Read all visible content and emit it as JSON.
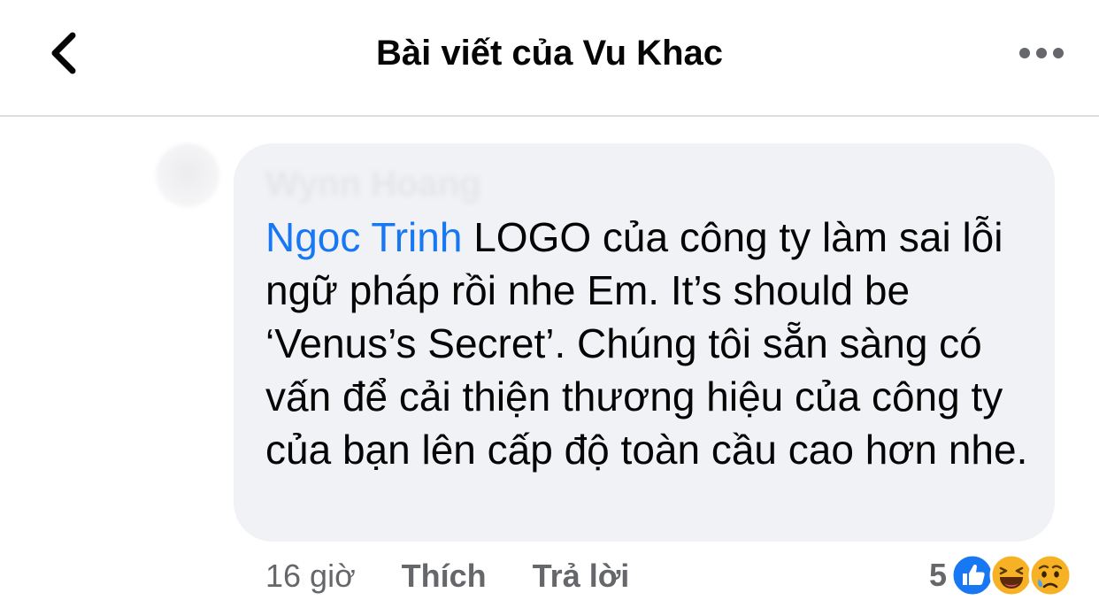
{
  "header": {
    "title": "Bài viết của Vu Khac",
    "back_icon": "chevron-left-icon",
    "more_icon": "more-horizontal-icon"
  },
  "comment": {
    "author": "Wynn Hoang",
    "mention": "Ngoc Trinh",
    "text": " LOGO của công ty làm sai lỗi ngữ pháp rồi nhe Em.  It’s should be ‘Venus’s Secret’.  Chúng tôi sẵn sàng có vấn để cải thiện thương hiệu của công ty của bạn lên cấp độ toàn cầu cao hơn nhe.",
    "timestamp": "16 giờ",
    "like_label": "Thích",
    "reply_label": "Trả lời",
    "reaction_count": "5",
    "reactions": [
      "like-icon",
      "haha-icon",
      "sad-icon"
    ]
  },
  "colors": {
    "mention": "#1877f2",
    "bubble": "#f0f2f5",
    "secondary_text": "#65676b",
    "primary_text": "#050505"
  }
}
